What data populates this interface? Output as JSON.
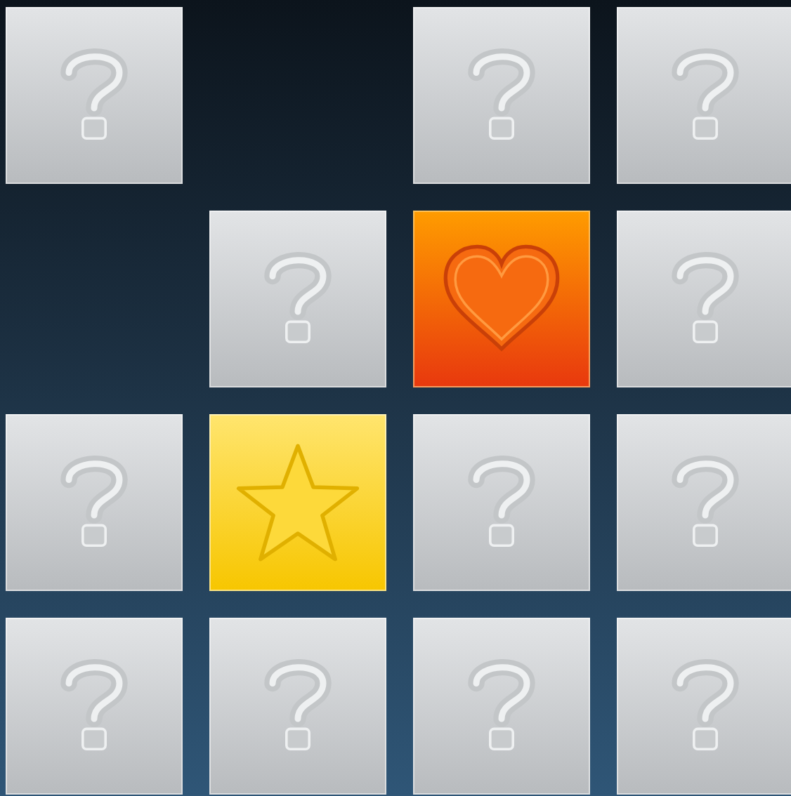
{
  "board": {
    "tiles": [
      {
        "kind": "hidden"
      },
      {
        "kind": "empty"
      },
      {
        "kind": "hidden"
      },
      {
        "kind": "hidden"
      },
      {
        "kind": "empty"
      },
      {
        "kind": "hidden"
      },
      {
        "kind": "heart"
      },
      {
        "kind": "hidden"
      },
      {
        "kind": "hidden"
      },
      {
        "kind": "star"
      },
      {
        "kind": "hidden"
      },
      {
        "kind": "hidden"
      },
      {
        "kind": "hidden"
      },
      {
        "kind": "hidden"
      },
      {
        "kind": "hidden"
      },
      {
        "kind": "hidden"
      }
    ]
  }
}
